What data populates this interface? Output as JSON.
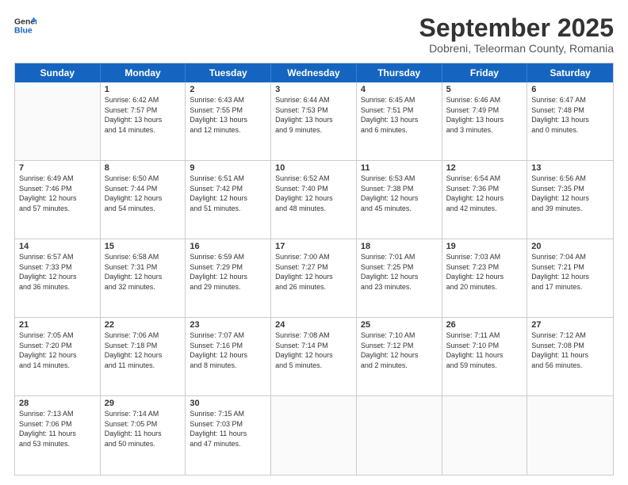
{
  "header": {
    "logo_line1": "General",
    "logo_line2": "Blue",
    "month": "September 2025",
    "location": "Dobreni, Teleorman County, Romania"
  },
  "weekdays": [
    "Sunday",
    "Monday",
    "Tuesday",
    "Wednesday",
    "Thursday",
    "Friday",
    "Saturday"
  ],
  "weeks": [
    [
      {
        "day": "",
        "info": ""
      },
      {
        "day": "1",
        "info": "Sunrise: 6:42 AM\nSunset: 7:57 PM\nDaylight: 13 hours\nand 14 minutes."
      },
      {
        "day": "2",
        "info": "Sunrise: 6:43 AM\nSunset: 7:55 PM\nDaylight: 13 hours\nand 12 minutes."
      },
      {
        "day": "3",
        "info": "Sunrise: 6:44 AM\nSunset: 7:53 PM\nDaylight: 13 hours\nand 9 minutes."
      },
      {
        "day": "4",
        "info": "Sunrise: 6:45 AM\nSunset: 7:51 PM\nDaylight: 13 hours\nand 6 minutes."
      },
      {
        "day": "5",
        "info": "Sunrise: 6:46 AM\nSunset: 7:49 PM\nDaylight: 13 hours\nand 3 minutes."
      },
      {
        "day": "6",
        "info": "Sunrise: 6:47 AM\nSunset: 7:48 PM\nDaylight: 13 hours\nand 0 minutes."
      }
    ],
    [
      {
        "day": "7",
        "info": "Sunrise: 6:49 AM\nSunset: 7:46 PM\nDaylight: 12 hours\nand 57 minutes."
      },
      {
        "day": "8",
        "info": "Sunrise: 6:50 AM\nSunset: 7:44 PM\nDaylight: 12 hours\nand 54 minutes."
      },
      {
        "day": "9",
        "info": "Sunrise: 6:51 AM\nSunset: 7:42 PM\nDaylight: 12 hours\nand 51 minutes."
      },
      {
        "day": "10",
        "info": "Sunrise: 6:52 AM\nSunset: 7:40 PM\nDaylight: 12 hours\nand 48 minutes."
      },
      {
        "day": "11",
        "info": "Sunrise: 6:53 AM\nSunset: 7:38 PM\nDaylight: 12 hours\nand 45 minutes."
      },
      {
        "day": "12",
        "info": "Sunrise: 6:54 AM\nSunset: 7:36 PM\nDaylight: 12 hours\nand 42 minutes."
      },
      {
        "day": "13",
        "info": "Sunrise: 6:56 AM\nSunset: 7:35 PM\nDaylight: 12 hours\nand 39 minutes."
      }
    ],
    [
      {
        "day": "14",
        "info": "Sunrise: 6:57 AM\nSunset: 7:33 PM\nDaylight: 12 hours\nand 36 minutes."
      },
      {
        "day": "15",
        "info": "Sunrise: 6:58 AM\nSunset: 7:31 PM\nDaylight: 12 hours\nand 32 minutes."
      },
      {
        "day": "16",
        "info": "Sunrise: 6:59 AM\nSunset: 7:29 PM\nDaylight: 12 hours\nand 29 minutes."
      },
      {
        "day": "17",
        "info": "Sunrise: 7:00 AM\nSunset: 7:27 PM\nDaylight: 12 hours\nand 26 minutes."
      },
      {
        "day": "18",
        "info": "Sunrise: 7:01 AM\nSunset: 7:25 PM\nDaylight: 12 hours\nand 23 minutes."
      },
      {
        "day": "19",
        "info": "Sunrise: 7:03 AM\nSunset: 7:23 PM\nDaylight: 12 hours\nand 20 minutes."
      },
      {
        "day": "20",
        "info": "Sunrise: 7:04 AM\nSunset: 7:21 PM\nDaylight: 12 hours\nand 17 minutes."
      }
    ],
    [
      {
        "day": "21",
        "info": "Sunrise: 7:05 AM\nSunset: 7:20 PM\nDaylight: 12 hours\nand 14 minutes."
      },
      {
        "day": "22",
        "info": "Sunrise: 7:06 AM\nSunset: 7:18 PM\nDaylight: 12 hours\nand 11 minutes."
      },
      {
        "day": "23",
        "info": "Sunrise: 7:07 AM\nSunset: 7:16 PM\nDaylight: 12 hours\nand 8 minutes."
      },
      {
        "day": "24",
        "info": "Sunrise: 7:08 AM\nSunset: 7:14 PM\nDaylight: 12 hours\nand 5 minutes."
      },
      {
        "day": "25",
        "info": "Sunrise: 7:10 AM\nSunset: 7:12 PM\nDaylight: 12 hours\nand 2 minutes."
      },
      {
        "day": "26",
        "info": "Sunrise: 7:11 AM\nSunset: 7:10 PM\nDaylight: 11 hours\nand 59 minutes."
      },
      {
        "day": "27",
        "info": "Sunrise: 7:12 AM\nSunset: 7:08 PM\nDaylight: 11 hours\nand 56 minutes."
      }
    ],
    [
      {
        "day": "28",
        "info": "Sunrise: 7:13 AM\nSunset: 7:06 PM\nDaylight: 11 hours\nand 53 minutes."
      },
      {
        "day": "29",
        "info": "Sunrise: 7:14 AM\nSunset: 7:05 PM\nDaylight: 11 hours\nand 50 minutes."
      },
      {
        "day": "30",
        "info": "Sunrise: 7:15 AM\nSunset: 7:03 PM\nDaylight: 11 hours\nand 47 minutes."
      },
      {
        "day": "",
        "info": ""
      },
      {
        "day": "",
        "info": ""
      },
      {
        "day": "",
        "info": ""
      },
      {
        "day": "",
        "info": ""
      }
    ]
  ]
}
